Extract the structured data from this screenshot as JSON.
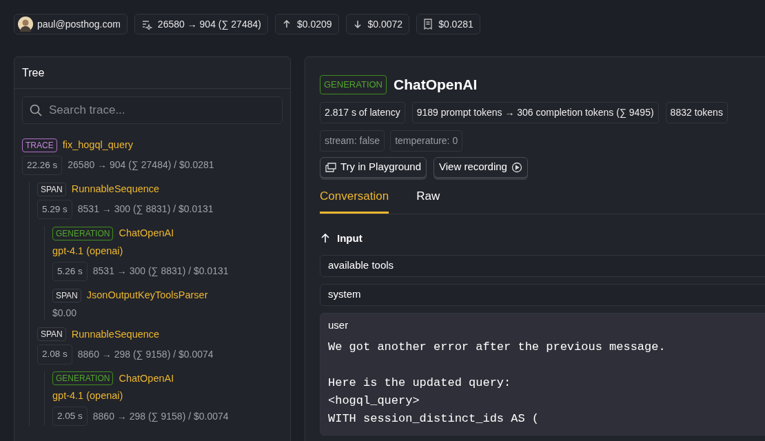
{
  "top_bar": {
    "user": "paul@posthog.com",
    "items": [
      "26580 → 904 (∑ 27484)",
      "$0.0209",
      "$0.0072",
      "$0.0281"
    ]
  },
  "tree": {
    "title": "Tree",
    "search": {
      "placeholder": "Search trace..."
    },
    "nodes": [
      {
        "kind": "trace",
        "badge": "TRACE",
        "name": "fix_hogql_query",
        "duration": "22.26 s",
        "stats": "26580 → 904 (∑ 27484) / $0.0281",
        "children": [
          {
            "kind": "span",
            "badge": "SPAN",
            "name": "RunnableSequence",
            "duration": "5.29 s",
            "stats": "8531 → 300 (∑ 8831) / $0.0131",
            "children": [
              {
                "kind": "generation",
                "badge": "GENERATION",
                "name": "ChatOpenAI",
                "model": "gpt-4.1 (openai)",
                "duration": "5.26 s",
                "stats": "8531 → 300 (∑ 8831) / $0.0131"
              },
              {
                "kind": "span",
                "badge": "SPAN",
                "name": "JsonOutputKeyToolsParser",
                "stats": "$0.00"
              }
            ]
          },
          {
            "kind": "span",
            "badge": "SPAN",
            "name": "RunnableSequence",
            "duration": "2.08 s",
            "stats": "8860 → 298 (∑ 9158) / $0.0074",
            "children": [
              {
                "kind": "generation",
                "badge": "GENERATION",
                "name": "ChatOpenAI",
                "model": "gpt-4.1 (openai)",
                "duration": "2.05 s",
                "stats": "8860 → 298 (∑ 9158) / $0.0074"
              }
            ]
          }
        ]
      }
    ]
  },
  "detail": {
    "badge": "GENERATION",
    "title": "ChatOpenAI",
    "metrics": [
      "2.817 s of latency",
      "9189 prompt tokens → 306 completion tokens (∑ 9495)",
      "8832 tokens"
    ],
    "params": [
      "stream: false",
      "temperature: 0"
    ],
    "buttons": [
      "Try in Playground",
      "View recording"
    ],
    "tabs": [
      {
        "label": "Conversation",
        "selected": true
      },
      {
        "label": "Raw",
        "selected": false
      }
    ],
    "section": "Input",
    "messages": [
      {
        "role": "available tools",
        "expanded": false
      },
      {
        "role": "system",
        "expanded": false
      },
      {
        "role": "user",
        "expanded": true,
        "content": "We got another error after the previous message.\n\nHere is the updated query:\n<hogql_query>\nWITH session_distinct_ids AS ("
      }
    ]
  }
}
